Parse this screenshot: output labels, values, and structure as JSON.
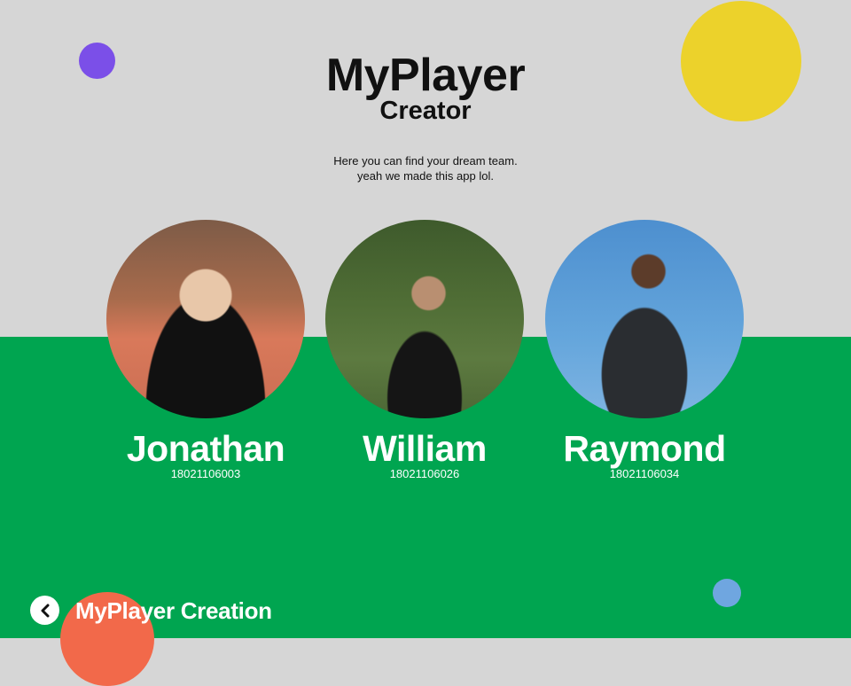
{
  "header": {
    "title": "MyPlayer",
    "subtitle": "Creator",
    "tagline_line1": "Here you can find your dream team.",
    "tagline_line2": "yeah we made this app lol."
  },
  "team": [
    {
      "name": "Jonathan",
      "id": "18021106003"
    },
    {
      "name": "William",
      "id": "18021106026"
    },
    {
      "name": "Raymond",
      "id": "18021106034"
    }
  ],
  "footer": {
    "back_icon": "chevron-left-icon",
    "title": "MyPlayer Creation"
  },
  "colors": {
    "background_top": "#d6d6d6",
    "background_bottom": "#00a550",
    "accent_purple": "#7b4fe8",
    "accent_yellow": "#ecd22b",
    "accent_blue": "#6fa6e0",
    "accent_orange": "#f2694a"
  }
}
